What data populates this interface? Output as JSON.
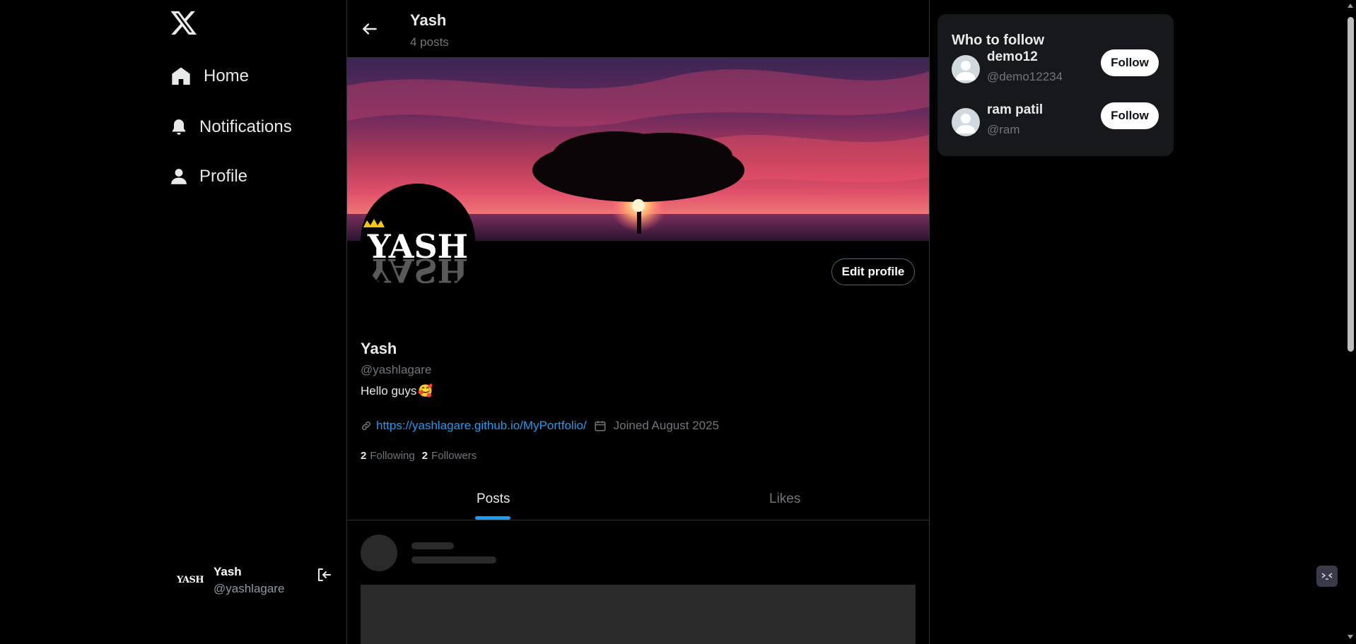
{
  "sidebar": {
    "items": [
      {
        "label": "Home",
        "icon": "home-icon"
      },
      {
        "label": "Notifications",
        "icon": "bell-icon"
      },
      {
        "label": "Profile",
        "icon": "user-icon"
      }
    ],
    "user": {
      "name": "Yash",
      "handle": "@yashlagare",
      "avatar_text": "YASH"
    }
  },
  "header": {
    "name": "Yash",
    "posts_count": "4 posts"
  },
  "profile": {
    "avatar_text": "YASH",
    "edit_label": "Edit profile",
    "name": "Yash",
    "handle": "@yashlagare",
    "bio": "Hello guys",
    "bio_emoji": "🥰",
    "link": "https://yashlagare.github.io/MyPortfolio/",
    "joined": "Joined August 2025",
    "following_count": "2",
    "following_label": "Following",
    "followers_count": "2",
    "followers_label": "Followers"
  },
  "tabs": [
    {
      "label": "Posts"
    },
    {
      "label": "Likes"
    }
  ],
  "who_to_follow": {
    "title": "Who to follow",
    "users": [
      {
        "name": "demo12",
        "handle": "@demo12234",
        "button": "Follow"
      },
      {
        "name": "ram patil",
        "handle": "@ram",
        "button": "Follow"
      }
    ]
  },
  "colors": {
    "accent": "#1d9bf0",
    "background": "#000000",
    "muted": "#71767b"
  }
}
